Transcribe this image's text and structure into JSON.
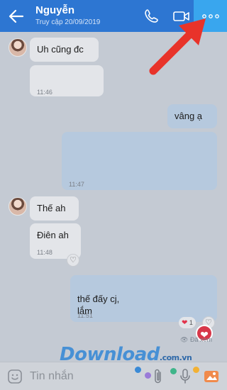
{
  "header": {
    "contact_name": "Nguyễn",
    "last_seen": "Truy cập 20/09/2019"
  },
  "messages": [
    {
      "text": "Uh cũng đc",
      "time": ""
    },
    {
      "text": "",
      "time": "11:46"
    },
    {
      "text": "vâng ạ",
      "time": ""
    },
    {
      "text": "",
      "time": "11:47"
    },
    {
      "text": "Thế ah",
      "time": ""
    },
    {
      "text": "Điên ah",
      "time": "11:48"
    },
    {
      "text": "thế đấy cj,\nlắm",
      "time": "11:51"
    }
  ],
  "reaction": {
    "count": "1"
  },
  "seen_label": "Đã xem",
  "watermark": {
    "text": "Download",
    "suffix": ".com.vn"
  },
  "composer": {
    "placeholder": "Tin nhắn"
  },
  "colors": {
    "header_bg": "#2d76d2",
    "more_highlight": "#39a6ee",
    "arrow": "#e8332a",
    "heart": "#d7384a"
  }
}
